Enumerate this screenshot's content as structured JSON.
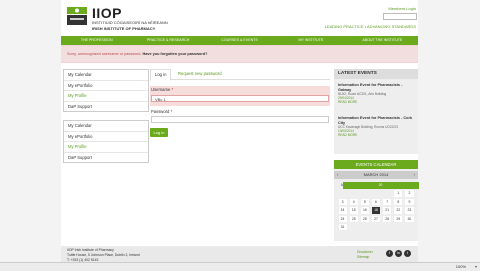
{
  "header": {
    "logo_text": "IIOP",
    "logo_sub1": "INSTITIÚID CÓGAISEOIRÍ NA hÉIREANN",
    "logo_sub2": "IRISH INSTITUTE OF PHARMACY",
    "member_login": "Members Login",
    "tagline": "LEADING PRACTICE  •  ADVANCING STANDARDS"
  },
  "nav": [
    "THE PROFESSION",
    "PRACTICE & RESEARCH",
    "COURSES & EVENTS",
    "MY INSTITUTE",
    "ABOUT THE INSTITUTE"
  ],
  "alert": {
    "text": "Sorry, unrecognized username or password.",
    "link": "Have you forgotten your password?"
  },
  "sidebar1": [
    "My Calendar",
    "My ePortfolio",
    "My Profile",
    "DaP Support"
  ],
  "sidebar2": [
    "My Calendar",
    "My ePortfolio",
    "My Profile",
    "DaP Support"
  ],
  "login": {
    "tab_login": "Log in",
    "tab_request": "Request new password",
    "username_label": "Username",
    "username_value": "VBc 1",
    "password_label": "Password",
    "required_mark": "*",
    "button": "Log in"
  },
  "events": {
    "heading": "LATEST EVENTS",
    "items": [
      {
        "title": "Information Event for Pharmacists - Galway",
        "location": "NUIG, Room AC201, Arts Building",
        "date": "29/04/2014",
        "more": "READ MORE"
      },
      {
        "title": "Information Event for Pharmacists - Cork City",
        "location": "UCC Kavanagh Building, Rooms UG22/23",
        "date": "13/05/2014",
        "more": "READ MORE"
      }
    ]
  },
  "calendar": {
    "heading": "EVENTS CALENDAR",
    "month": "MARCH 2014",
    "prev": "‹",
    "next": "›",
    "dow": [
      "M",
      "T",
      "W",
      "T",
      "F",
      "S",
      "S"
    ],
    "days": [
      "",
      "",
      "",
      "",
      "",
      "1",
      "2",
      "3",
      "4",
      "5",
      "6",
      "7",
      "8",
      "9",
      "10",
      "11",
      "12",
      "13",
      "14",
      "15",
      "16",
      "17",
      "18",
      "19",
      "20",
      "21",
      "22",
      "23",
      "24",
      "25",
      "26",
      "27",
      "28",
      "29",
      "30",
      "31",
      "",
      "",
      "",
      "",
      "",
      ""
    ],
    "highlight": [
      "10",
      "11",
      "12",
      "13",
      "17",
      "19",
      "20"
    ],
    "today": "18"
  },
  "footer": {
    "line1": "IIOP Irish Institute of Pharmacy",
    "line2": "Tuttle House, 5 Johnson Place, Dublin 2, Ireland",
    "line3": "T: +353 (1) 402 5143",
    "link1": "Disclaimer",
    "link2": "Sitemap",
    "social": [
      "f",
      "in",
      "t"
    ]
  },
  "statusbar": {
    "zoom": "100%"
  },
  "colors": {
    "brand_green": "#6aaa1c",
    "error_bg": "#f2dede",
    "error_text": "#b94a48"
  }
}
